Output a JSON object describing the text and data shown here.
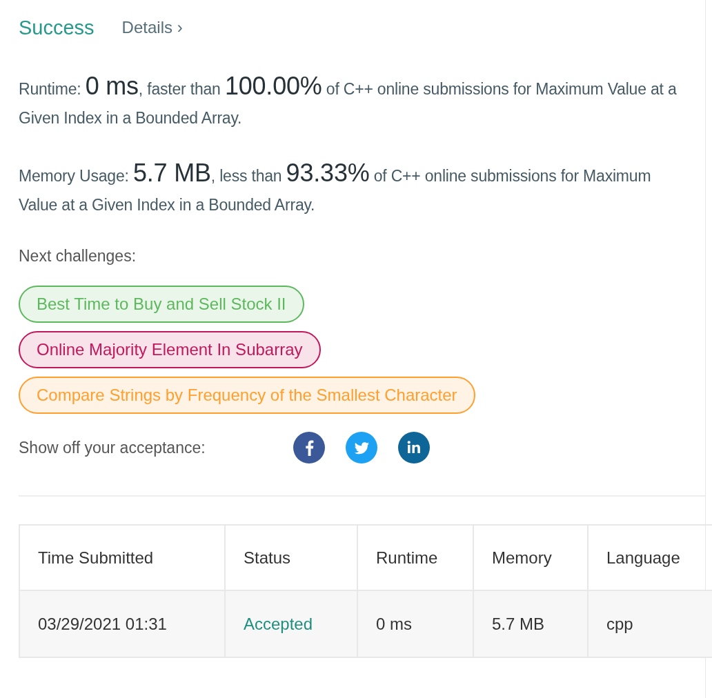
{
  "header": {
    "title": "Success",
    "details_link": "Details",
    "details_chevron": "›"
  },
  "stats": [
    {
      "segments": [
        {
          "kind": "plain",
          "text": "Runtime: "
        },
        {
          "kind": "big",
          "text": "0 ms"
        },
        {
          "kind": "plain",
          "text": ", faster than "
        },
        {
          "kind": "big",
          "text": "100.00%"
        },
        {
          "kind": "plain",
          "text": " of C++ online submissions for Maximum Value at a Given Index in a Bounded Array."
        }
      ]
    },
    {
      "segments": [
        {
          "kind": "plain",
          "text": "Memory Usage: "
        },
        {
          "kind": "big",
          "text": "5.7 MB"
        },
        {
          "kind": "plain",
          "text": ", less than "
        },
        {
          "kind": "big",
          "text": "93.33%"
        },
        {
          "kind": "plain",
          "text": " of C++ online submissions for Maximum Value at a Given Index in a Bounded Array."
        }
      ]
    }
  ],
  "next_challenges": {
    "label": "Next challenges:",
    "items": [
      {
        "title": "Best Time to Buy and Sell Stock II",
        "color": "#5cb85c"
      },
      {
        "title": "Online Majority Element In Subarray",
        "color": "#c2185b"
      },
      {
        "title": "Compare Strings by Frequency of the Smallest Character",
        "color": "#ff9f2e"
      }
    ]
  },
  "share": {
    "label": "Show off your acceptance:",
    "networks": [
      {
        "kind": "facebook"
      },
      {
        "kind": "twitter"
      },
      {
        "kind": "linkedin"
      }
    ]
  },
  "table": {
    "columns": [
      {
        "label": "Time Submitted",
        "kind": "text"
      },
      {
        "label": "Status",
        "kind": "status"
      },
      {
        "label": "Runtime",
        "kind": "text"
      },
      {
        "label": "Memory",
        "kind": "text"
      },
      {
        "label": "Language",
        "kind": "text"
      }
    ],
    "rows": [
      {
        "cells": [
          "03/29/2021 01:31",
          "Accepted",
          "0 ms",
          "5.7 MB",
          "cpp"
        ]
      }
    ]
  }
}
